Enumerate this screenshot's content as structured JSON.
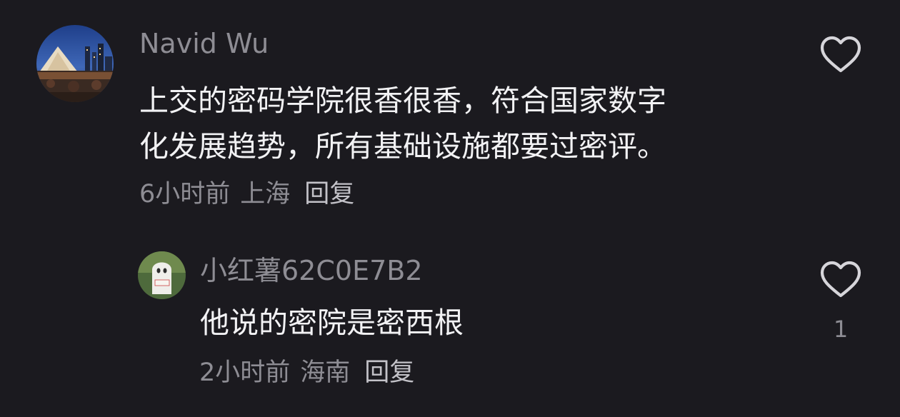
{
  "comments": [
    {
      "author": "Navid Wu",
      "text_lines": [
        "上交的密码学院很香很香，符合国家数字",
        "化发展趋势，所有基础设施都要过密评。"
      ],
      "time": "6小时前",
      "location": "上海",
      "reply_label": "回复",
      "like_icon": "heart-outline-icon",
      "like_count": ""
    },
    {
      "author": "小红薯62C0E7B2",
      "text_lines": [
        "他说的密院是密西根"
      ],
      "time": "2小时前",
      "location": "海南",
      "reply_label": "回复",
      "like_icon": "heart-outline-icon",
      "like_count": "1"
    }
  ],
  "colors": {
    "background": "#1b1a1f",
    "primary_text": "#f2f2f4",
    "secondary_text": "#8e8d94",
    "reply_text": "#c3c2c8"
  }
}
